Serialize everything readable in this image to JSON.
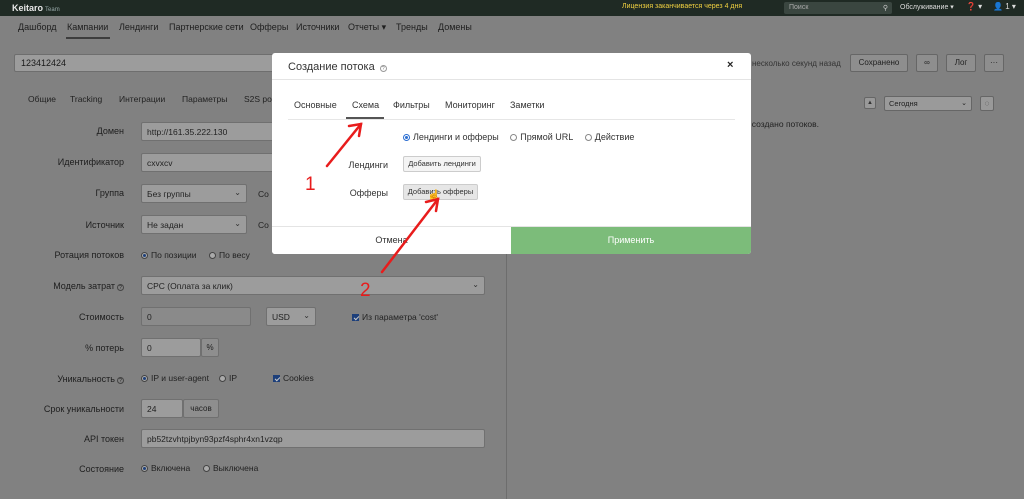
{
  "topbar": {
    "logo": "Keitaro",
    "logo_sub": "Team",
    "license_warning": "Лицензия заканчивается через 4 дня",
    "search_placeholder": "Поиск",
    "service_menu": "Обслуживание ▾",
    "help_menu": "❓ ▾",
    "user_menu": "1 ▾"
  },
  "nav": {
    "items": [
      "Дашборд",
      "Кампании",
      "Лендинги",
      "Партнерские сети",
      "Офферы",
      "Источники",
      "Отчеты ▾",
      "Тренды",
      "Домены"
    ],
    "active": "Кампании"
  },
  "campaign": {
    "name_value": "123412424",
    "saved_note": "несколько секунд назад",
    "save_button": "Сохранено",
    "link_button": "∞",
    "log_button": "Лог",
    "more_button": "···"
  },
  "subtabs": [
    "Общие",
    "Tracking",
    "Интеграции",
    "Параметры",
    "S2S po"
  ],
  "right_panel": {
    "period_value": "Сегодня",
    "no_flows": "не создано потоков."
  },
  "form": {
    "domain": {
      "label": "Домен",
      "value": "http://161.35.222.130"
    },
    "identifier": {
      "label": "Идентификатор",
      "value": "cxvxcv"
    },
    "group": {
      "label": "Группа",
      "value": "Без группы",
      "extra": "Со"
    },
    "source": {
      "label": "Источник",
      "value": "Не задан",
      "extra": "Со"
    },
    "rotation": {
      "label": "Ротация потоков",
      "opt1": "По позиции",
      "opt2": "По весу"
    },
    "cost_model": {
      "label": "Модель затрат",
      "value": "CPC (Оплата за клик)"
    },
    "cost": {
      "label": "Стоимость",
      "value": "0",
      "currency": "USD",
      "param": "Из параметра 'cost'"
    },
    "loss": {
      "label": "% потерь",
      "value": "0",
      "unit": "%"
    },
    "uniqueness": {
      "label": "Уникальность",
      "opt1": "IP и user-agent",
      "opt2": "IP",
      "opt3": "Cookies"
    },
    "uniq_period": {
      "label": "Срок уникальности",
      "value": "24",
      "unit": "часов"
    },
    "api_token": {
      "label": "API токен",
      "value": "pb52tzvhtpjbyn93pzf4sphr4xn1vzqp"
    },
    "state": {
      "label": "Состояние",
      "opt1": "Включена",
      "opt2": "Выключена"
    }
  },
  "modal": {
    "title": "Создание потока",
    "close": "×",
    "tabs": [
      "Основные",
      "Схема",
      "Фильтры",
      "Мониторинг",
      "Заметки"
    ],
    "active_tab": "Схема",
    "scheme_options": [
      "Лендинги и офферы",
      "Прямой URL",
      "Действие"
    ],
    "selected_scheme": "Лендинги и офферы",
    "landings_label": "Лендинги",
    "add_landing_button": "Добавить лендинги",
    "offers_label": "Офферы",
    "add_offer_button": "Добавить офферы",
    "cancel_button": "Отмена",
    "apply_button": "Применить"
  },
  "annotations": {
    "color": "#e81c1c",
    "label_1": "1",
    "label_2": "2"
  }
}
